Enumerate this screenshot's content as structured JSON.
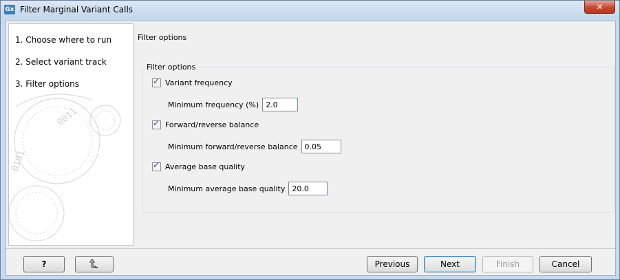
{
  "window": {
    "title": "Filter Marginal Variant Calls",
    "app_icon_text": "Gx",
    "close_glyph": "✕"
  },
  "steps": [
    {
      "label": "1.  Choose where to run"
    },
    {
      "label": "2.  Select variant track"
    },
    {
      "label": "3.  Filter options"
    }
  ],
  "panel": {
    "heading": "Filter options",
    "group_title": "Filter options",
    "options": [
      {
        "label": "Variant frequency",
        "checked": true,
        "field_label": "Minimum frequency (%)",
        "value": "2.0"
      },
      {
        "label": "Forward/reverse balance",
        "checked": true,
        "field_label": "Minimum forward/reverse balance",
        "value": "0.05"
      },
      {
        "label": "Average base quality",
        "checked": true,
        "field_label": "Minimum average base quality",
        "value": "20.0"
      }
    ]
  },
  "buttons": {
    "help": "?",
    "reset_icon": "reset-arrow-icon",
    "previous": "Previous",
    "next": "Next",
    "finish": "Finish",
    "cancel": "Cancel"
  },
  "colors": {
    "title_bar": "#c7daee",
    "close_button": "#c8462f",
    "checkbox_tick": "#24467a"
  }
}
